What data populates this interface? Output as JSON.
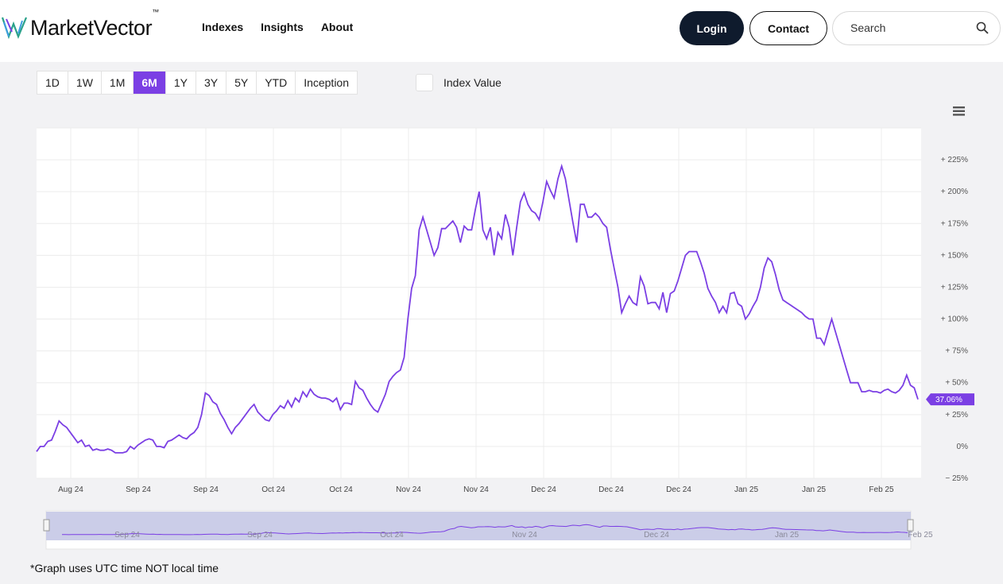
{
  "header": {
    "logo_text": "MarketVector",
    "logo_tm": "™",
    "nav": [
      "Indexes",
      "Insights",
      "About"
    ],
    "login_label": "Login",
    "contact_label": "Contact",
    "search_placeholder": "Search"
  },
  "toolbar": {
    "ranges": [
      "1D",
      "1W",
      "1M",
      "6M",
      "1Y",
      "3Y",
      "5Y",
      "YTD",
      "Inception"
    ],
    "active_range": "6M",
    "index_value_label": "Index Value",
    "index_value_checked": false
  },
  "colors": {
    "accent": "#7b3fe4",
    "dark": "#0f1b2d",
    "navigator_fill": "#c5c8e6"
  },
  "footnote": "*Graph uses UTC time NOT local time",
  "chart_data": {
    "type": "line",
    "y_tick_labels": [
      "− 25%",
      "0%",
      "+ 25%",
      "+ 50%",
      "+ 75%",
      "+ 100%",
      "+ 125%",
      "+ 150%",
      "+ 175%",
      "+ 200%",
      "+ 225%"
    ],
    "x_tick_labels": [
      "Aug 24",
      "Sep 24",
      "Sep 24",
      "Oct 24",
      "Oct 24",
      "Nov 24",
      "Nov 24",
      "Dec 24",
      "Dec 24",
      "Dec 24",
      "Jan 25",
      "Jan 25",
      "Feb 25"
    ],
    "ylim": [
      -25,
      250
    ],
    "grid": true,
    "current_value_label": "37.06%",
    "series": [
      {
        "values": [
          -4,
          0,
          0,
          4,
          5,
          12,
          20,
          17,
          15,
          11,
          7,
          3,
          5,
          0,
          1,
          -3,
          -2,
          -3,
          -3,
          -2,
          -3,
          -5,
          -5,
          -5,
          -4,
          0,
          -2,
          1,
          3,
          5,
          6,
          5,
          0,
          0,
          -1,
          4,
          5,
          7,
          9,
          7,
          6,
          9,
          11,
          15,
          25,
          42,
          40,
          35,
          33,
          26,
          21,
          15,
          10,
          15,
          18,
          22,
          26,
          30,
          33,
          27,
          24,
          21,
          20,
          25,
          28,
          32,
          30,
          36,
          31,
          38,
          35,
          43,
          39,
          45,
          41,
          39,
          38,
          38,
          37,
          35,
          38,
          29,
          34,
          34,
          33,
          51,
          46,
          44,
          38,
          33,
          29,
          27,
          34,
          41,
          51,
          55,
          58,
          60,
          70,
          100,
          124,
          134,
          170,
          180,
          170,
          160,
          150,
          156,
          171,
          171,
          174,
          177,
          172,
          160,
          173,
          170,
          170,
          186,
          200,
          170,
          163,
          172,
          150,
          168,
          163,
          182,
          172,
          150,
          172,
          192,
          199,
          190,
          185,
          183,
          178,
          192,
          208,
          201,
          195,
          210,
          220,
          210,
          193,
          176,
          160,
          190,
          190,
          180,
          180,
          183,
          180,
          175,
          172,
          155,
          140,
          125,
          105,
          112,
          118,
          113,
          111,
          133,
          126,
          112,
          113,
          113,
          108,
          121,
          105,
          120,
          122,
          130,
          140,
          150,
          153,
          153,
          153,
          145,
          136,
          124,
          118,
          113,
          105,
          110,
          105,
          120,
          121,
          112,
          110,
          100,
          104,
          110,
          115,
          125,
          140,
          148,
          145,
          135,
          123,
          115,
          113,
          111,
          109,
          107,
          105,
          102,
          100,
          100,
          85,
          85,
          80,
          90,
          100,
          90,
          80,
          70,
          60,
          50,
          50,
          50,
          43,
          43,
          44,
          43,
          43,
          42,
          44,
          45,
          43,
          42,
          44,
          48,
          56,
          48,
          46,
          37
        ]
      }
    ],
    "navigator": {
      "x_tick_labels": [
        "Sep 24",
        "Sep 24",
        "Oct 24",
        "Nov 24",
        "Dec 24",
        "Jan 25",
        "Feb 25"
      ]
    }
  }
}
